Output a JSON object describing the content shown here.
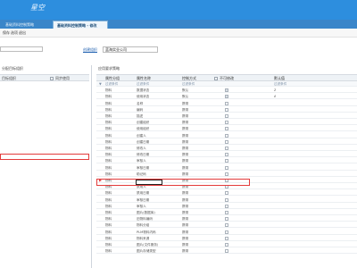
{
  "app": {
    "logo": "星空"
  },
  "tabs": [
    {
      "label": "基础资料控制策略",
      "active": false
    },
    {
      "label": "基础资料控制策略 - 修改",
      "active": true
    }
  ],
  "toolbar": {
    "item1": "保存",
    "item2": "选项",
    "item3": "退出"
  },
  "form": {
    "org_label": "创建组织",
    "org_value": "蓝海实业公司"
  },
  "left_panel": {
    "title": "分配目标组织",
    "col_target": "目标组织",
    "col_sync": "同步使用"
  },
  "right_panel": {
    "title": "应用要求策略",
    "columns": [
      "属性分组",
      "属性名称",
      "控制方式",
      "不可修改",
      "默认值"
    ],
    "filter_row": [
      "过滤条件",
      "过滤条件",
      "过滤条件",
      "",
      "过滤条件"
    ],
    "rows": [
      {
        "group": "物料",
        "name": "数据状态",
        "mode": "默认",
        "locked": true,
        "default": "Z"
      },
      {
        "group": "物料",
        "name": "使用状态",
        "mode": "默认",
        "locked": true,
        "default": "A"
      },
      {
        "group": "物料",
        "name": "名称",
        "mode": "携带",
        "locked": false,
        "default": ""
      },
      {
        "group": "物料",
        "name": "编码",
        "mode": "携带",
        "locked": false,
        "default": ""
      },
      {
        "group": "物料",
        "name": "描述",
        "mode": "携带",
        "locked": false,
        "default": ""
      },
      {
        "group": "物料",
        "name": "创建组织",
        "mode": "携带",
        "locked": false,
        "default": ""
      },
      {
        "group": "物料",
        "name": "使用组织",
        "mode": "携带",
        "locked": false,
        "default": ""
      },
      {
        "group": "物料",
        "name": "创建人",
        "mode": "携带",
        "locked": false,
        "default": ""
      },
      {
        "group": "物料",
        "name": "创建日期",
        "mode": "携带",
        "locked": false,
        "default": ""
      },
      {
        "group": "物料",
        "name": "修改人",
        "mode": "携带",
        "locked": false,
        "default": ""
      },
      {
        "group": "物料",
        "name": "修改日期",
        "mode": "携带",
        "locked": false,
        "default": ""
      },
      {
        "group": "物料",
        "name": "审核人",
        "mode": "携带",
        "locked": false,
        "default": ""
      },
      {
        "group": "物料",
        "name": "审核日期",
        "mode": "携带",
        "locked": false,
        "default": ""
      },
      {
        "group": "物料",
        "name": "助记码",
        "mode": "携带",
        "locked": false,
        "default": ""
      },
      {
        "group": "物料",
        "name": "规格型号",
        "mode": "携带",
        "locked": false,
        "default": "",
        "selected": true
      },
      {
        "group": "物料",
        "name": "禁用人",
        "mode": "携带",
        "locked": false,
        "default": ""
      },
      {
        "group": "物料",
        "name": "禁用日期",
        "mode": "携带",
        "locked": false,
        "default": ""
      },
      {
        "group": "物料",
        "name": "审核日期",
        "mode": "携带",
        "locked": false,
        "default": ""
      },
      {
        "group": "物料",
        "name": "审核人",
        "mode": "携带",
        "locked": false,
        "default": ""
      },
      {
        "group": "物料",
        "name": "图片(数据库)",
        "mode": "携带",
        "locked": false,
        "default": ""
      },
      {
        "group": "物料",
        "name": "旧物料编码",
        "mode": "携带",
        "locked": false,
        "default": ""
      },
      {
        "group": "物料",
        "name": "物料分组",
        "mode": "携带",
        "locked": false,
        "default": ""
      },
      {
        "group": "物料",
        "name": "PLM物料内码",
        "mode": "携带",
        "locked": false,
        "default": ""
      },
      {
        "group": "物料",
        "name": "物料来源",
        "mode": "携带",
        "locked": false,
        "default": ""
      },
      {
        "group": "物料",
        "name": "图片(文件服务)",
        "mode": "携带",
        "locked": false,
        "default": ""
      },
      {
        "group": "物料",
        "name": "图片存储类型",
        "mode": "携带",
        "locked": false,
        "default": ""
      }
    ]
  }
}
